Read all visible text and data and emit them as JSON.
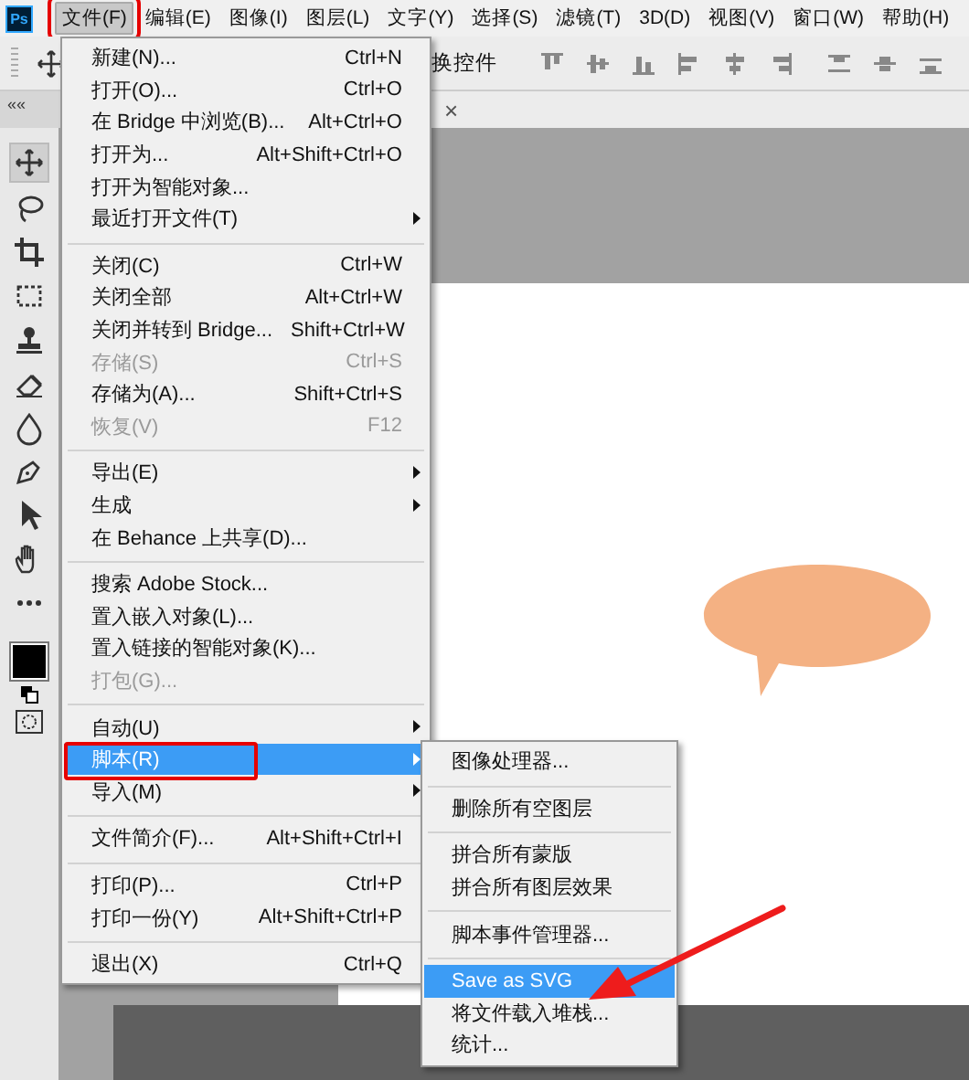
{
  "app": {
    "logo": "Ps"
  },
  "menubar": [
    {
      "label": "文件(F)",
      "selected": true,
      "outlined": true
    },
    {
      "label": "编辑(E)",
      "selected": false,
      "outlined": false
    },
    {
      "label": "图像(I)",
      "selected": false,
      "outlined": false
    },
    {
      "label": "图层(L)",
      "selected": false,
      "outlined": false
    },
    {
      "label": "文字(Y)",
      "selected": false,
      "outlined": false
    },
    {
      "label": "选择(S)",
      "selected": false,
      "outlined": false
    },
    {
      "label": "滤镜(T)",
      "selected": false,
      "outlined": false
    },
    {
      "label": "3D(D)",
      "selected": false,
      "outlined": false
    },
    {
      "label": "视图(V)",
      "selected": false,
      "outlined": false
    },
    {
      "label": "窗口(W)",
      "selected": false,
      "outlined": false
    },
    {
      "label": "帮助(H)",
      "selected": false,
      "outlined": false
    }
  ],
  "options_bar": {
    "text": "换控件"
  },
  "tab_bar": {
    "collapse": "««",
    "close": "×"
  },
  "file_menu": [
    {
      "kind": "item",
      "label": "新建(N)...",
      "shortcut": "Ctrl+N",
      "disabled": false,
      "submenu": false,
      "selected": false,
      "outlined": false
    },
    {
      "kind": "item",
      "label": "打开(O)...",
      "shortcut": "Ctrl+O",
      "disabled": false,
      "submenu": false,
      "selected": false,
      "outlined": false
    },
    {
      "kind": "item",
      "label": "在 Bridge 中浏览(B)...",
      "shortcut": "Alt+Ctrl+O",
      "disabled": false,
      "submenu": false,
      "selected": false,
      "outlined": false
    },
    {
      "kind": "item",
      "label": "打开为...",
      "shortcut": "Alt+Shift+Ctrl+O",
      "disabled": false,
      "submenu": false,
      "selected": false,
      "outlined": false
    },
    {
      "kind": "item",
      "label": "打开为智能对象...",
      "disabled": false,
      "submenu": false,
      "selected": false,
      "outlined": false
    },
    {
      "kind": "item",
      "label": "最近打开文件(T)",
      "disabled": false,
      "submenu": true,
      "selected": false,
      "outlined": false
    },
    {
      "kind": "separator"
    },
    {
      "kind": "item",
      "label": "关闭(C)",
      "shortcut": "Ctrl+W",
      "disabled": false,
      "submenu": false,
      "selected": false,
      "outlined": false
    },
    {
      "kind": "item",
      "label": "关闭全部",
      "shortcut": "Alt+Ctrl+W",
      "disabled": false,
      "submenu": false,
      "selected": false,
      "outlined": false
    },
    {
      "kind": "item",
      "label": "关闭并转到 Bridge...",
      "shortcut": "Shift+Ctrl+W",
      "disabled": false,
      "submenu": false,
      "selected": false,
      "outlined": false
    },
    {
      "kind": "item",
      "label": "存储(S)",
      "shortcut": "Ctrl+S",
      "disabled": true,
      "submenu": false,
      "selected": false,
      "outlined": false
    },
    {
      "kind": "item",
      "label": "存储为(A)...",
      "shortcut": "Shift+Ctrl+S",
      "disabled": false,
      "submenu": false,
      "selected": false,
      "outlined": false
    },
    {
      "kind": "item",
      "label": "恢复(V)",
      "shortcut": "F12",
      "disabled": true,
      "submenu": false,
      "selected": false,
      "outlined": false
    },
    {
      "kind": "separator"
    },
    {
      "kind": "item",
      "label": "导出(E)",
      "disabled": false,
      "submenu": true,
      "selected": false,
      "outlined": false
    },
    {
      "kind": "item",
      "label": "生成",
      "disabled": false,
      "submenu": true,
      "selected": false,
      "outlined": false
    },
    {
      "kind": "item",
      "label": "在 Behance 上共享(D)...",
      "disabled": false,
      "submenu": false,
      "selected": false,
      "outlined": false
    },
    {
      "kind": "separator"
    },
    {
      "kind": "item",
      "label": "搜索 Adobe Stock...",
      "disabled": false,
      "submenu": false,
      "selected": false,
      "outlined": false
    },
    {
      "kind": "item",
      "label": "置入嵌入对象(L)...",
      "disabled": false,
      "submenu": false,
      "selected": false,
      "outlined": false
    },
    {
      "kind": "item",
      "label": "置入链接的智能对象(K)...",
      "disabled": false,
      "submenu": false,
      "selected": false,
      "outlined": false
    },
    {
      "kind": "item",
      "label": "打包(G)...",
      "disabled": true,
      "submenu": false,
      "selected": false,
      "outlined": false
    },
    {
      "kind": "separator"
    },
    {
      "kind": "item",
      "label": "自动(U)",
      "disabled": false,
      "submenu": true,
      "selected": false,
      "outlined": false
    },
    {
      "kind": "item",
      "label": "脚本(R)",
      "disabled": false,
      "submenu": true,
      "selected": true,
      "outlined": true
    },
    {
      "kind": "item",
      "label": "导入(M)",
      "disabled": false,
      "submenu": true,
      "selected": false,
      "outlined": false
    },
    {
      "kind": "separator"
    },
    {
      "kind": "item",
      "label": "文件简介(F)...",
      "shortcut": "Alt+Shift+Ctrl+I",
      "disabled": false,
      "submenu": false,
      "selected": false,
      "outlined": false
    },
    {
      "kind": "separator"
    },
    {
      "kind": "item",
      "label": "打印(P)...",
      "shortcut": "Ctrl+P",
      "disabled": false,
      "submenu": false,
      "selected": false,
      "outlined": false
    },
    {
      "kind": "item",
      "label": "打印一份(Y)",
      "shortcut": "Alt+Shift+Ctrl+P",
      "disabled": false,
      "submenu": false,
      "selected": false,
      "outlined": false
    },
    {
      "kind": "separator"
    },
    {
      "kind": "item",
      "label": "退出(X)",
      "shortcut": "Ctrl+Q",
      "disabled": false,
      "submenu": false,
      "selected": false,
      "outlined": false
    }
  ],
  "scripts_submenu": [
    {
      "kind": "item",
      "label": "图像处理器...",
      "disabled": false,
      "submenu": false,
      "selected": false,
      "outlined": false
    },
    {
      "kind": "separator"
    },
    {
      "kind": "item",
      "label": "删除所有空图层",
      "disabled": false,
      "submenu": false,
      "selected": false,
      "outlined": false
    },
    {
      "kind": "separator"
    },
    {
      "kind": "item",
      "label": "拼合所有蒙版",
      "disabled": false,
      "submenu": false,
      "selected": false,
      "outlined": false
    },
    {
      "kind": "item",
      "label": "拼合所有图层效果",
      "disabled": false,
      "submenu": false,
      "selected": false,
      "outlined": false
    },
    {
      "kind": "separator"
    },
    {
      "kind": "item",
      "label": "脚本事件管理器...",
      "disabled": false,
      "submenu": false,
      "selected": false,
      "outlined": false
    },
    {
      "kind": "separator"
    },
    {
      "kind": "item",
      "label": "Save as SVG",
      "disabled": false,
      "submenu": false,
      "selected": true,
      "outlined": false
    },
    {
      "kind": "item",
      "label": "将文件载入堆栈...",
      "disabled": false,
      "submenu": false,
      "selected": false,
      "outlined": false
    },
    {
      "kind": "item",
      "label": "统计...",
      "disabled": false,
      "submenu": false,
      "selected": false,
      "outlined": false
    }
  ],
  "annotations": [
    {
      "kind": "arrow"
    }
  ]
}
